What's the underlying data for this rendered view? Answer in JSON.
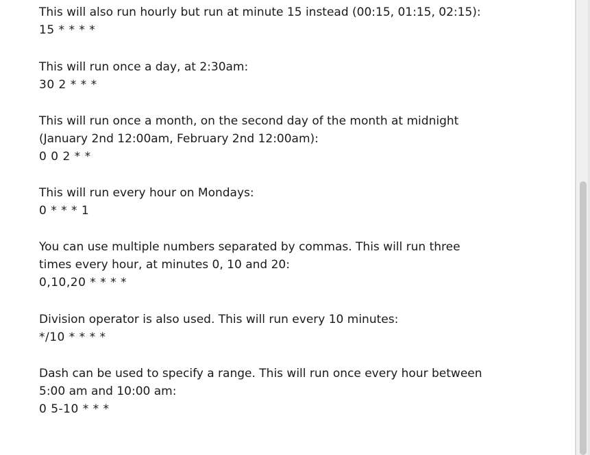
{
  "sections": [
    {
      "lines": [
        "This will also run hourly but run at minute 15 instead (00:15, 01:15, 02:15):"
      ],
      "code": "15 * * * *"
    },
    {
      "lines": [
        "This will run once a day, at 2:30am:"
      ],
      "code": "30 2 * * *"
    },
    {
      "lines": [
        "This will run once a month, on the second day of the month at midnight",
        "(January 2nd 12:00am, February 2nd 12:00am):"
      ],
      "code": "0 0 2 * *"
    },
    {
      "lines": [
        "This will run every hour on Mondays:"
      ],
      "code": "0 * * * 1"
    },
    {
      "lines": [
        "You can use multiple numbers separated by commas. This will run three",
        "times every hour, at minutes 0, 10 and 20:"
      ],
      "code": "0,10,20 * * * *"
    },
    {
      "lines": [
        "Division operator is also used. This will run every 10 minutes:"
      ],
      "code": "*/10 * * * *"
    },
    {
      "lines": [
        "Dash can be used to specify a range. This will run once every hour between",
        "5:00 am and 10:00 am:"
      ],
      "code": "0 5-10 * * *"
    }
  ]
}
